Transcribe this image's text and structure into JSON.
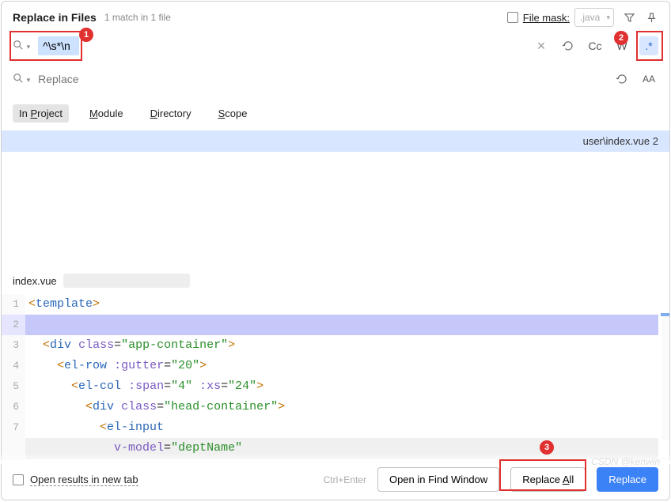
{
  "header": {
    "title": "Replace in Files",
    "matches": "1 match in 1 file",
    "filemask_label": "File mask:",
    "filemask_value": ".java"
  },
  "search": {
    "value": "^\\s*\\n",
    "clear": "×",
    "cc": "Cc",
    "w": "W",
    "regex": ".*"
  },
  "replace": {
    "placeholder": "Replace",
    "preserve": "AA"
  },
  "scope": {
    "tabs": [
      "In Project",
      "Module",
      "Directory",
      "Scope"
    ]
  },
  "result": {
    "line": "user\\index.vue 2"
  },
  "preview": {
    "filename": "index.vue",
    "lines": [
      {
        "n": 1,
        "kind": "code"
      },
      {
        "n": 2,
        "kind": "hl"
      },
      {
        "n": 3,
        "kind": "code"
      },
      {
        "n": 4,
        "kind": "code"
      },
      {
        "n": 5,
        "kind": "code"
      },
      {
        "n": 6,
        "kind": "code"
      },
      {
        "n": 7,
        "kind": "code"
      },
      {
        "n": 8,
        "kind": "caret"
      }
    ]
  },
  "code_tokens": {
    "l1_template": "template",
    "l3_div": "div",
    "l3_class": "class",
    "l3_val": "\"app-container\"",
    "l4_elrow": "el-row",
    "l4_gutter": ":gutter",
    "l4_val": "\"20\"",
    "l5_elcol": "el-col",
    "l5_span": ":span",
    "l5_spanv": "\"4\"",
    "l5_xs": ":xs",
    "l5_xsv": "\"24\"",
    "l6_div": "div",
    "l6_class": "class",
    "l6_val": "\"head-container\"",
    "l7_elinput": "el-input",
    "l8_vmodel": "v-model",
    "l8_val": "\"deptName\""
  },
  "footer": {
    "open_tab": "Open results in new tab",
    "shortcut": "Ctrl+Enter",
    "open_window": "Open in Find Window",
    "replace_all": "Replace All",
    "replace": "Replace"
  },
  "badges": {
    "b1": "1",
    "b2": "2",
    "b3": "3"
  },
  "watermark": "CSDN @kenwin"
}
